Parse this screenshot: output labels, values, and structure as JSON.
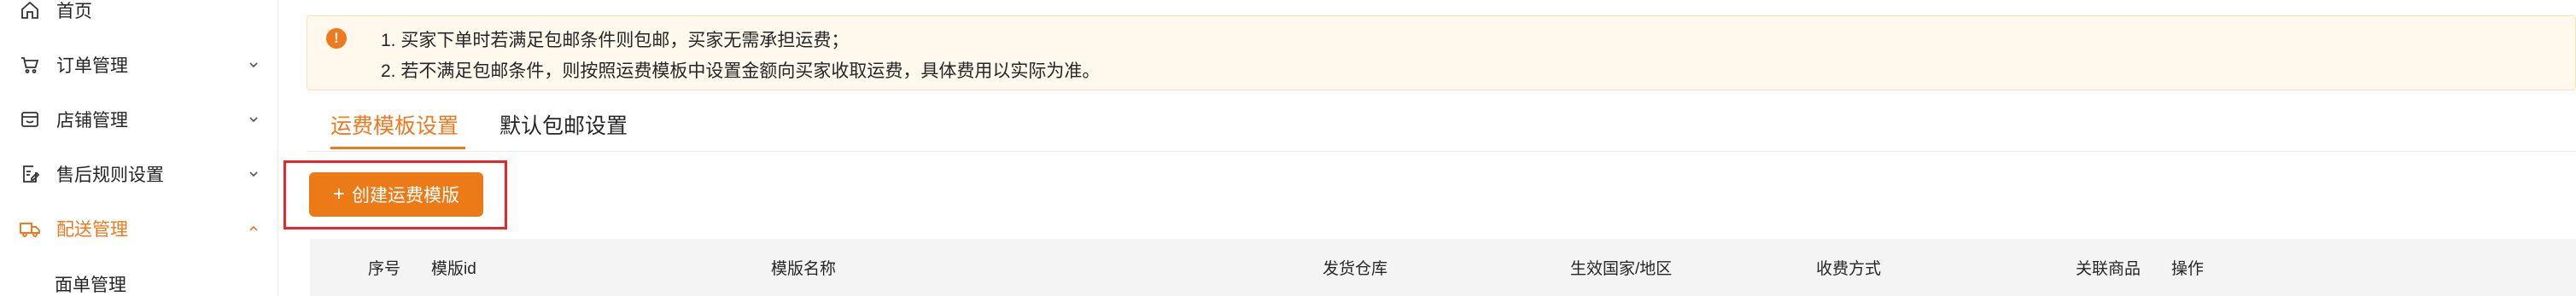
{
  "sidebar": {
    "items": [
      {
        "label": "首页",
        "icon": "home-icon",
        "has_chevron": false
      },
      {
        "label": "订单管理",
        "icon": "cart-icon",
        "has_chevron": true
      },
      {
        "label": "店铺管理",
        "icon": "store-icon",
        "has_chevron": true
      },
      {
        "label": "售后规则设置",
        "icon": "edit-doc-icon",
        "has_chevron": true
      },
      {
        "label": "配送管理",
        "icon": "truck-icon",
        "has_chevron": true,
        "active": true,
        "expanded": true
      }
    ],
    "sub_items": [
      {
        "label": "面单管理"
      }
    ],
    "active_color": "#f0781e"
  },
  "notice": {
    "icon": "warning-circle-icon",
    "lines": [
      "1. 买家下单时若满足包邮条件则包邮，买家无需承担运费；",
      "2. 若不满足包邮条件，则按照运费模板中设置金额向买家收取运费，具体费用以实际为准。"
    ],
    "background": "#fff8ec"
  },
  "tabs": [
    {
      "label": "运费模板设置",
      "active": true
    },
    {
      "label": "默认包邮设置",
      "active": false
    }
  ],
  "toolbar": {
    "create_label": "创建运费模版",
    "create_icon": "plus-icon",
    "button_color": "#ec7a16",
    "highlight_color": "#e8262c"
  },
  "table": {
    "columns": [
      "序号",
      "模版id",
      "模版名称",
      "发货仓库",
      "生效国家/地区",
      "收费方式",
      "关联商品",
      "操作"
    ]
  }
}
